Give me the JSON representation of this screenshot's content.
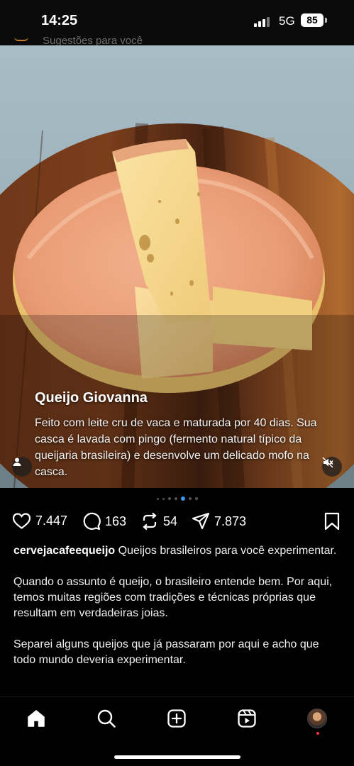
{
  "status_bar": {
    "time": "14:25",
    "network": "5G",
    "battery": "85"
  },
  "header": {
    "suggestions_text": "Sugestões para você"
  },
  "post": {
    "overlay_title": "Queijo Giovanna",
    "overlay_description": "Feito com leite cru de vaca e maturada por 40 dias. Sua casca é lavada com pingo (fermento natural típico da queijaria brasileira) e desenvolve um delicado mofo na casca.",
    "carousel": {
      "total_dots": 7,
      "active_index": 4
    },
    "actions": {
      "likes": "7.447",
      "comments": "163",
      "reposts": "54",
      "shares": "7.873"
    },
    "caption": {
      "username": "cervejacafeequeijo",
      "first_line": "Queijos brasileiros para você experimentar.",
      "paragraph_2": "Quando o assunto é queijo, o brasileiro entende bem. Por aqui, temos muitas regiões com tradições e técnicas próprias que resultam em verdadeiras joias.",
      "paragraph_3": "Separei alguns queijos que já passaram por aqui e acho que todo mundo deveria experimentar."
    }
  },
  "bottom_nav": {
    "items": [
      "home-icon",
      "search-icon",
      "create-icon",
      "reels-icon",
      "profile-avatar"
    ]
  },
  "colors": {
    "background": "#000000",
    "text": "#f5f5f5",
    "active_dot": "#3897f0",
    "notification": "#ff3040"
  }
}
